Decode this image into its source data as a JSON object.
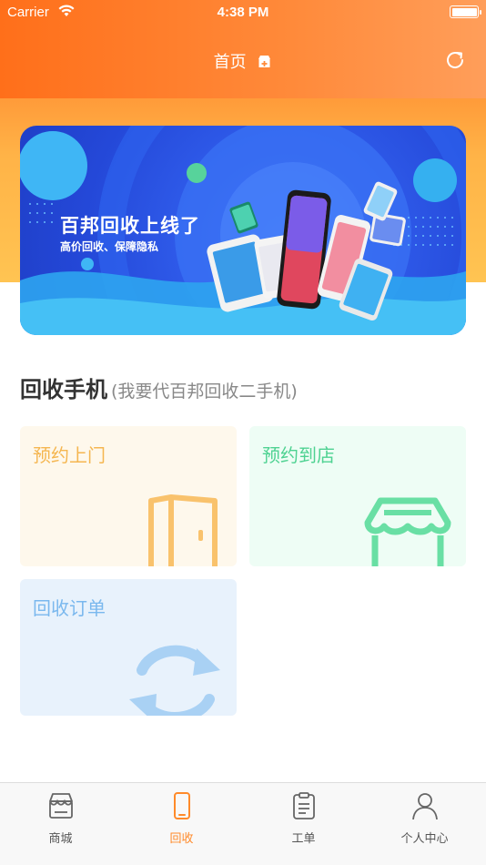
{
  "status_bar": {
    "carrier": "Carrier",
    "time": "4:38 PM"
  },
  "nav": {
    "title": "首页",
    "title_icon": "shop-plus-icon",
    "right_icon": "refresh-icon"
  },
  "banner": {
    "title": "百邦回收上线了",
    "subtitle": "高价回收、保障隐私"
  },
  "section": {
    "title": "回收手机",
    "subtitle": "(我要代百邦回收二手机)"
  },
  "cards": [
    {
      "label": "预约上门",
      "icon": "door-icon",
      "color": "#f5b650",
      "background": "#fef8ec"
    },
    {
      "label": "预约到店",
      "icon": "store-icon",
      "color": "#4fd292",
      "background": "#eefdf5"
    },
    {
      "label": "回收订单",
      "icon": "recycle-arrows-icon",
      "color": "#7ab8ee",
      "background": "#e8f2fc"
    }
  ],
  "tabbar": {
    "active_index": 1,
    "active_color": "#ff8a2a",
    "items": [
      {
        "label": "商城",
        "icon": "store-icon"
      },
      {
        "label": "回收",
        "icon": "phone-icon"
      },
      {
        "label": "工单",
        "icon": "clipboard-icon"
      },
      {
        "label": "个人中心",
        "icon": "person-icon"
      }
    ]
  }
}
